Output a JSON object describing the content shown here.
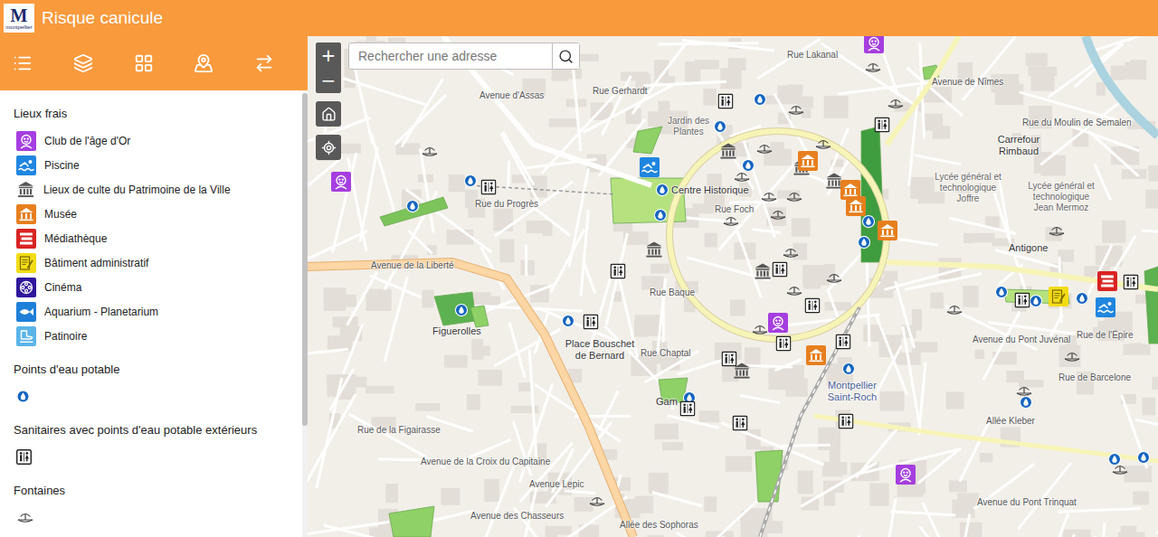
{
  "header": {
    "logo": {
      "letter": "M",
      "sub": "montpellier"
    },
    "title": "Risque canicule"
  },
  "search": {
    "placeholder": "Rechercher une adresse"
  },
  "zoom": {
    "in": "+",
    "out": "−"
  },
  "sidebar": {
    "scrollbar": {
      "level": 0.75
    }
  },
  "legend": {
    "sections": [
      {
        "title": "Lieux frais",
        "items": [
          {
            "kind": "club",
            "label": "Club de l'âge d'Or",
            "color": "#a53ee0"
          },
          {
            "kind": "pool",
            "label": "Piscine",
            "color": "#1f86e0"
          },
          {
            "kind": "worship",
            "label": "Lieux de culte du Patrimoine de la Ville",
            "color": "#555555"
          },
          {
            "kind": "museum",
            "label": "Musée",
            "color": "#e77f1e"
          },
          {
            "kind": "media",
            "label": "Médiathèque",
            "color": "#d92323"
          },
          {
            "kind": "admin",
            "label": "Bâtiment administratif",
            "color": "#f3dc14"
          },
          {
            "kind": "cinema",
            "label": "Cinéma",
            "color": "#30169c"
          },
          {
            "kind": "aquarium",
            "label": "Aquarium - Planetarium",
            "color": "#1e7fd8"
          },
          {
            "kind": "rink",
            "label": "Patinoire",
            "color": "#5ab4e8"
          }
        ]
      },
      {
        "title": "Points d'eau potable",
        "items": [
          {
            "kind": "water"
          }
        ]
      },
      {
        "title": "Sanitaires avec points d'eau potable extérieurs",
        "items": [
          {
            "kind": "toilet"
          }
        ]
      },
      {
        "title": "Fontaines",
        "items": [
          {
            "kind": "fountain"
          }
        ]
      }
    ]
  },
  "map": {
    "labels": [
      {
        "text": "Rue Lakanal",
        "kind": "street"
      },
      {
        "text": "Avenue d'Assas",
        "kind": "street"
      },
      {
        "text": "Rue Gerhardt",
        "kind": "street"
      },
      {
        "text": "Jardin des Plantes",
        "kind": "poi"
      },
      {
        "text": "Avenue de Nîmes",
        "kind": "street"
      },
      {
        "text": "Rue du Moulin de Semalen",
        "kind": "street"
      },
      {
        "text": "Carrefour Rimbaud",
        "kind": "place"
      },
      {
        "text": "Lycée général et technologique Joffre",
        "kind": "poi"
      },
      {
        "text": "Lycée général et technologique Jean Mermoz",
        "kind": "poi"
      },
      {
        "text": "Centre Historique",
        "kind": "place"
      },
      {
        "text": "Rue du Progrès",
        "kind": "street"
      },
      {
        "text": "Rue Foch",
        "kind": "street"
      },
      {
        "text": "Antigone",
        "kind": "place"
      },
      {
        "text": "Avenue de la Liberté",
        "kind": "street"
      },
      {
        "text": "Rue Baque",
        "kind": "street"
      },
      {
        "text": "Figuerolles",
        "kind": "place"
      },
      {
        "text": "Avenue du Pont Juvénal",
        "kind": "street"
      },
      {
        "text": "Rue de l'Épire",
        "kind": "street"
      },
      {
        "text": "Place Bouschet de Bernard",
        "kind": "place"
      },
      {
        "text": "Rue Chaptal",
        "kind": "street"
      },
      {
        "text": "Rue de Barcelone",
        "kind": "street"
      },
      {
        "text": "Montpellier Saint-Roch",
        "kind": "station"
      },
      {
        "text": "Gam",
        "kind": "place"
      },
      {
        "text": "Allée Kleber",
        "kind": "street"
      },
      {
        "text": "Rue de la Figairasse",
        "kind": "street"
      },
      {
        "text": "Avenue de la Croix du Capitaine",
        "kind": "street"
      },
      {
        "text": "Avenue Lepic",
        "kind": "street"
      },
      {
        "text": "Avenue du Pont Trinquat",
        "kind": "street"
      },
      {
        "text": "Avenue des Chasseurs",
        "kind": "street"
      },
      {
        "text": "Allée des Sophoras",
        "kind": "street"
      }
    ],
    "markers": [
      {
        "kind": "water"
      },
      {
        "kind": "water"
      },
      {
        "kind": "water"
      },
      {
        "kind": "water"
      },
      {
        "kind": "water"
      },
      {
        "kind": "water"
      },
      {
        "kind": "water"
      },
      {
        "kind": "water"
      },
      {
        "kind": "water"
      },
      {
        "kind": "water"
      },
      {
        "kind": "water"
      },
      {
        "kind": "water"
      },
      {
        "kind": "water"
      },
      {
        "kind": "water"
      },
      {
        "kind": "water"
      },
      {
        "kind": "water"
      },
      {
        "kind": "water"
      },
      {
        "kind": "water"
      },
      {
        "kind": "water"
      },
      {
        "kind": "toilet"
      },
      {
        "kind": "toilet"
      },
      {
        "kind": "toilet"
      },
      {
        "kind": "toilet"
      },
      {
        "kind": "toilet"
      },
      {
        "kind": "toilet"
      },
      {
        "kind": "toilet"
      },
      {
        "kind": "toilet"
      },
      {
        "kind": "toilet"
      },
      {
        "kind": "toilet"
      },
      {
        "kind": "toilet"
      },
      {
        "kind": "toilet"
      },
      {
        "kind": "toilet"
      },
      {
        "kind": "toilet"
      },
      {
        "kind": "toilet"
      },
      {
        "kind": "fountain"
      },
      {
        "kind": "fountain"
      },
      {
        "kind": "fountain"
      },
      {
        "kind": "fountain"
      },
      {
        "kind": "fountain"
      },
      {
        "kind": "fountain"
      },
      {
        "kind": "fountain"
      },
      {
        "kind": "fountain"
      },
      {
        "kind": "fountain"
      },
      {
        "kind": "fountain"
      },
      {
        "kind": "fountain"
      },
      {
        "kind": "fountain"
      },
      {
        "kind": "fountain"
      },
      {
        "kind": "fountain"
      },
      {
        "kind": "fountain"
      },
      {
        "kind": "fountain"
      },
      {
        "kind": "fountain"
      },
      {
        "kind": "fountain"
      },
      {
        "kind": "fountain"
      },
      {
        "kind": "fountain"
      },
      {
        "kind": "fountain"
      },
      {
        "kind": "worship"
      },
      {
        "kind": "worship"
      },
      {
        "kind": "worship"
      },
      {
        "kind": "worship"
      },
      {
        "kind": "worship"
      },
      {
        "kind": "worship"
      },
      {
        "kind": "museum"
      },
      {
        "kind": "museum"
      },
      {
        "kind": "museum"
      },
      {
        "kind": "museum"
      },
      {
        "kind": "museum"
      },
      {
        "kind": "club"
      },
      {
        "kind": "club"
      },
      {
        "kind": "club"
      },
      {
        "kind": "club"
      },
      {
        "kind": "pool"
      },
      {
        "kind": "pool"
      },
      {
        "kind": "media"
      },
      {
        "kind": "admin"
      }
    ]
  }
}
